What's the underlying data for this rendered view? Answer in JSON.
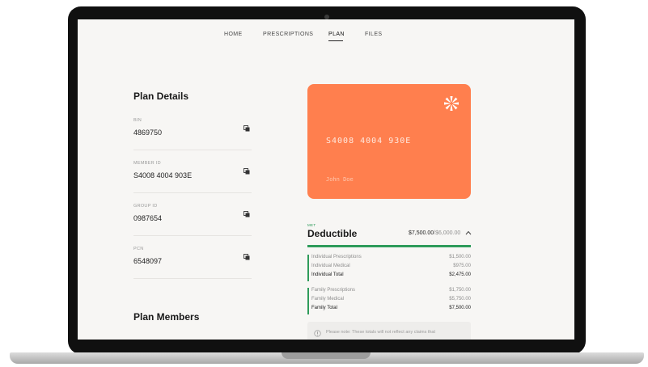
{
  "nav": {
    "items": [
      {
        "label": "HOME"
      },
      {
        "label": "PRESCRIPTIONS"
      },
      {
        "label": "PLAN",
        "active": true
      },
      {
        "label": "FILES"
      }
    ]
  },
  "plan_details": {
    "title": "Plan Details",
    "fields": [
      {
        "label": "BIN",
        "value": "4869750"
      },
      {
        "label": "MEMBER ID",
        "value": "S4008 4004 903E"
      },
      {
        "label": "GROUP ID",
        "value": "0987654"
      },
      {
        "label": "PCN",
        "value": "6548097"
      }
    ]
  },
  "plan_members": {
    "title": "Plan Members"
  },
  "card": {
    "number": "S4008 4004 930E",
    "name": "John Doe",
    "color": "#ff7f4e"
  },
  "deductible": {
    "met_label": "MET",
    "title": "Deductible",
    "amount": "$7,500.00",
    "total": "/$6,000.00",
    "accent": "#2e9b5a",
    "individual": [
      {
        "label": "Individual Prescriptions",
        "amount": "$1,500.00"
      },
      {
        "label": "Individual Medical",
        "amount": "$975.00"
      },
      {
        "label": "Individual Total",
        "amount": "$2,475.00"
      }
    ],
    "family": [
      {
        "label": "Family Prescriptions",
        "amount": "$1,750.00"
      },
      {
        "label": "Family Medical",
        "amount": "$5,750.00"
      },
      {
        "label": "Family Total",
        "amount": "$7,500.00"
      }
    ],
    "note": "Please note: These totals will not reflect any claims that"
  },
  "icons": {
    "copy": "copy-icon",
    "chevron": "chevron-up-icon",
    "info": "info-icon",
    "logo": "pinwheel-logo-icon"
  }
}
